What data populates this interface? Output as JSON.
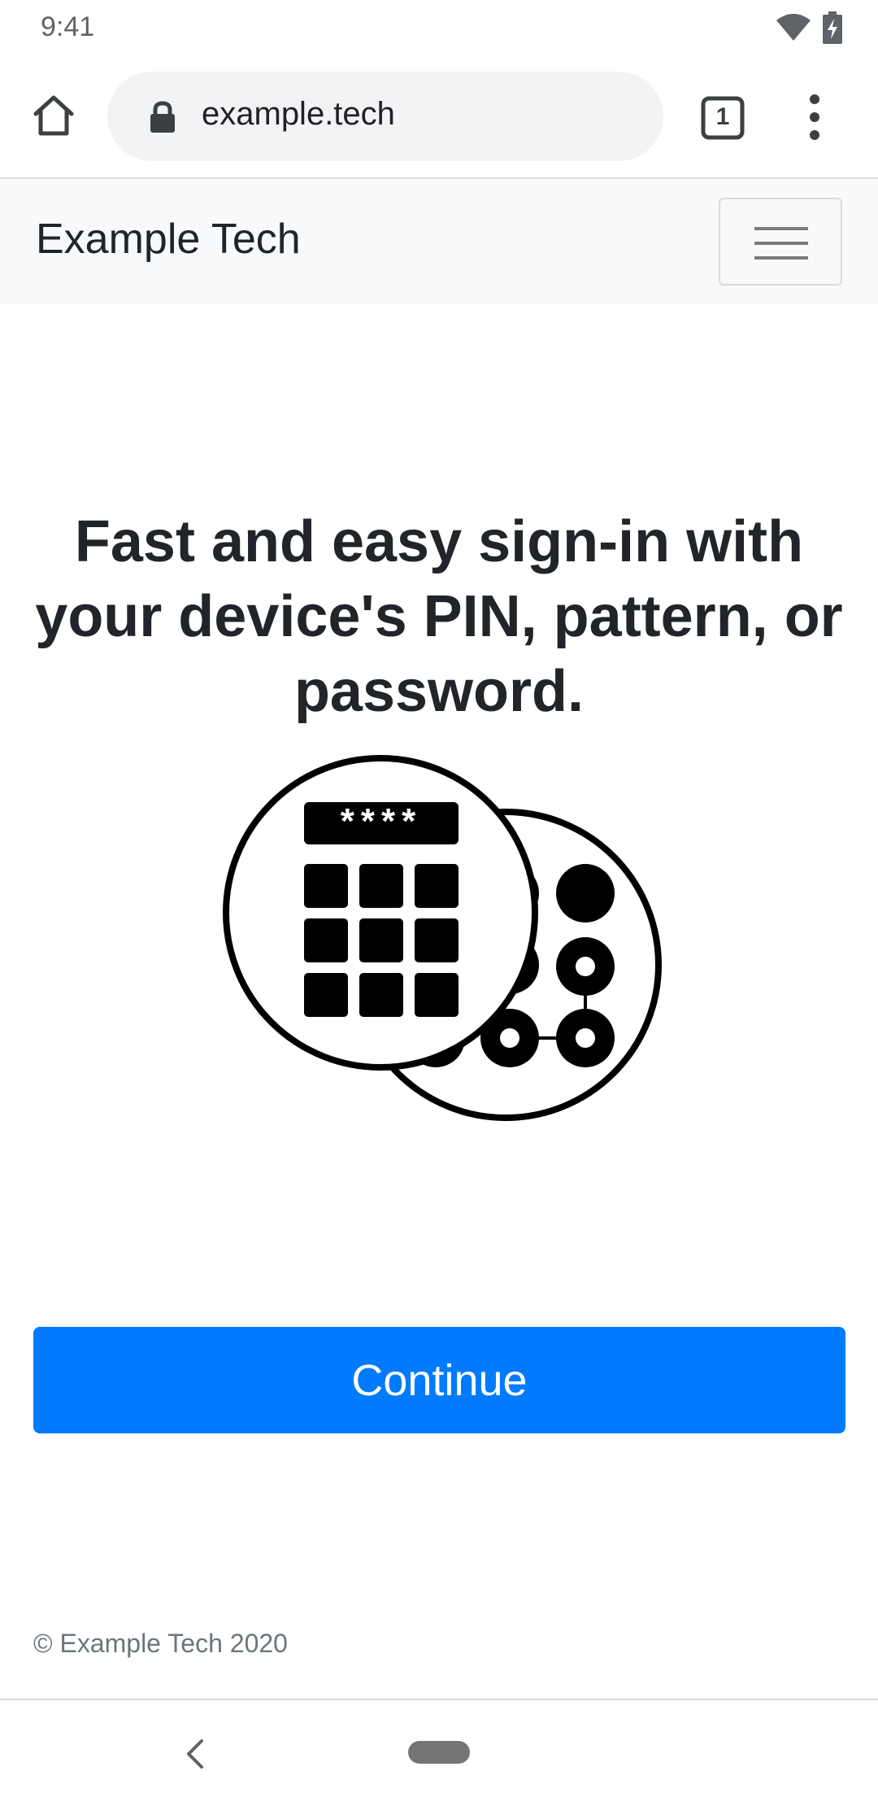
{
  "status_bar": {
    "time": "9:41",
    "icons": [
      "wifi-icon",
      "battery-charging-icon"
    ]
  },
  "browser": {
    "url": "example.tech",
    "tab_count": "1",
    "icons": [
      "home-icon",
      "lock-icon",
      "tab-switcher-icon",
      "more-vert-icon"
    ]
  },
  "navbar": {
    "brand": "Example Tech",
    "toggler_icon": "hamburger-icon"
  },
  "main": {
    "headline": "Fast and easy sign-in with your device's PIN, pattern, or password.",
    "illustration": {
      "pin_mask": "****",
      "icons": [
        "pin-keypad-icon",
        "pattern-lock-icon"
      ]
    },
    "continue_label": "Continue"
  },
  "footer": {
    "copyright": "© Example Tech 2020"
  },
  "colors": {
    "primary": "#007bff",
    "navbar_bg": "#f8f9fa",
    "text": "#212529",
    "muted": "#6c757d"
  }
}
